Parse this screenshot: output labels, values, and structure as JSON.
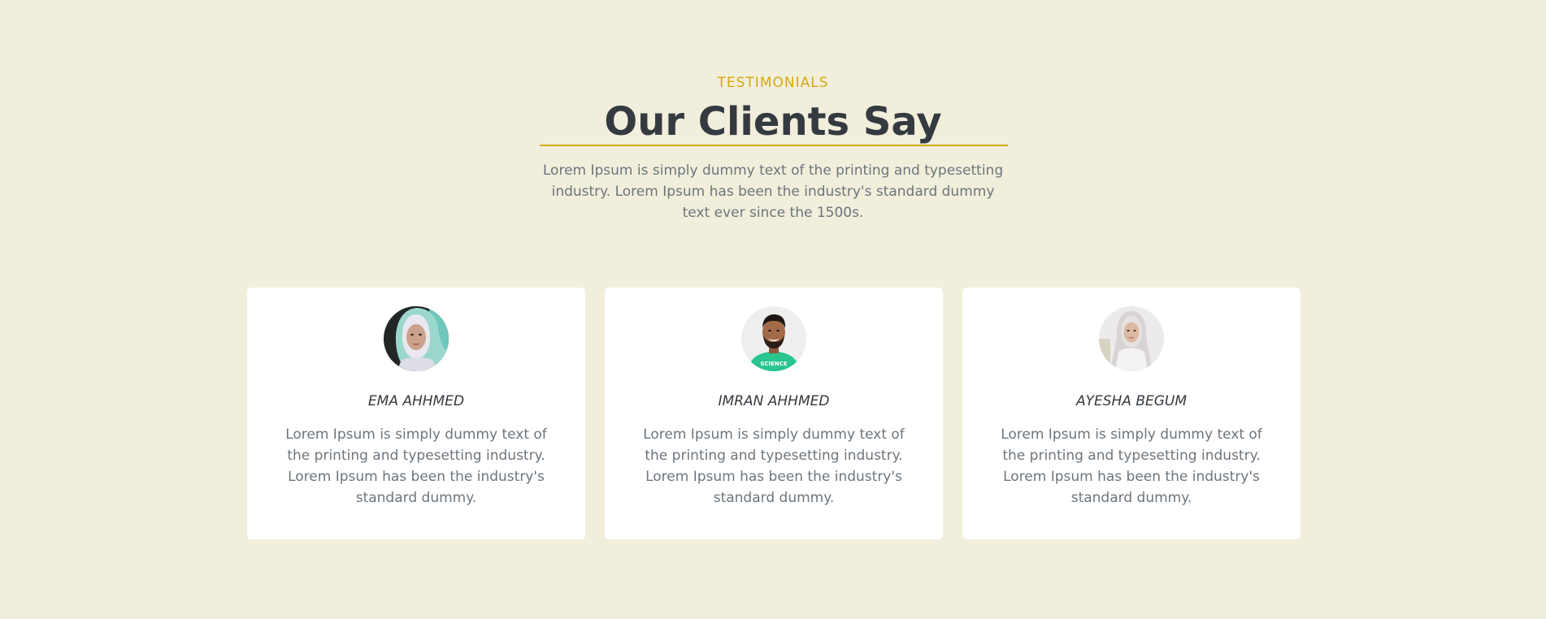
{
  "section": {
    "eyebrow": "TESTIMONIALS",
    "title": "Our Clients Say",
    "intro": "Lorem Ipsum is simply dummy text of the printing and typesetting industry. Lorem Ipsum has been the industry's standard dummy text ever since the 1500s."
  },
  "colors": {
    "background": "#f1eedb",
    "accent": "#d4a90f",
    "heading": "#343a40",
    "body_text": "#6c757d",
    "card": "#ffffff"
  },
  "testimonials": [
    {
      "name": "EMA AHHMED",
      "quote": "Lorem Ipsum is simply dummy text of the printing and typesetting industry. Lorem Ipsum has been the industry's standard dummy.",
      "avatar": "avatar-woman-hijab-teal"
    },
    {
      "name": "IMRAN AHHMED",
      "quote": "Lorem Ipsum is simply dummy text of the printing and typesetting industry. Lorem Ipsum has been the industry's standard dummy.",
      "avatar": "avatar-man-green-shirt",
      "shirt_text": "SCIENCE"
    },
    {
      "name": "AYESHA BEGUM",
      "quote": "Lorem Ipsum is simply dummy text of the printing and typesetting industry. Lorem Ipsum has been the industry's standard dummy.",
      "avatar": "avatar-woman-hijab-white"
    }
  ]
}
